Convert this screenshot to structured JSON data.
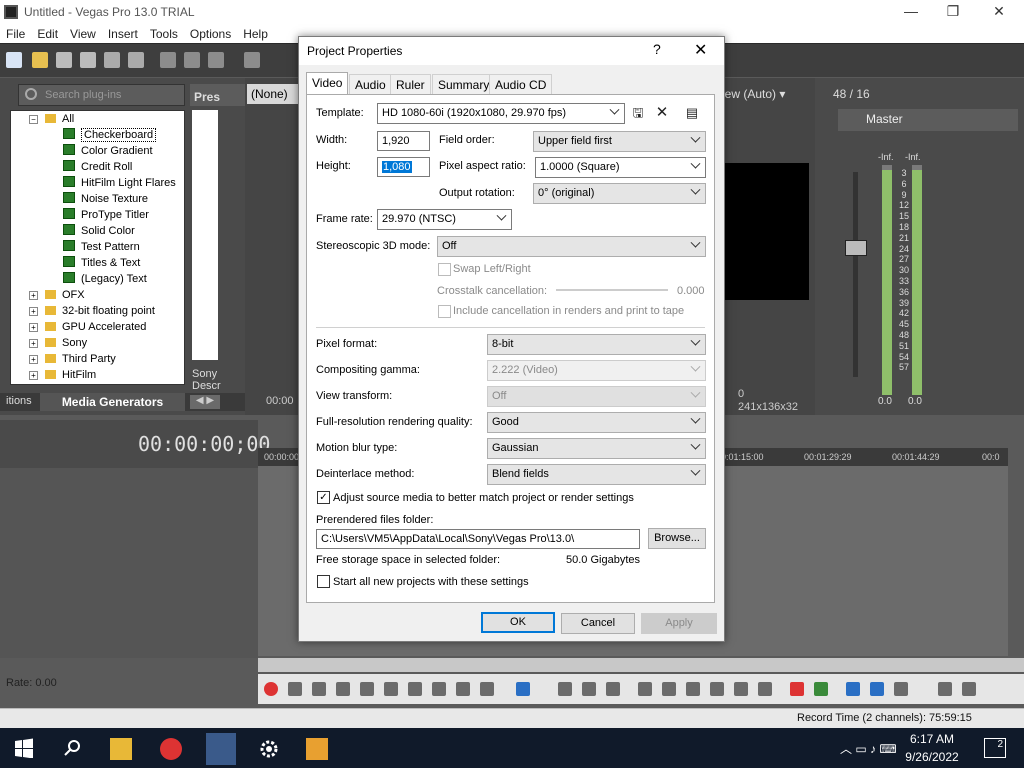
{
  "window": {
    "title": "Untitled - Vegas Pro 13.0 TRIAL",
    "min": "—",
    "max": "❐",
    "close": "✕"
  },
  "menu": [
    "File",
    "Edit",
    "View",
    "Insert",
    "Tools",
    "Options",
    "Help"
  ],
  "left_panel": {
    "search_placeholder": "Search plug-ins",
    "presets_tab": "Pres",
    "tree": {
      "root": "All",
      "generators": [
        "Checkerboard",
        "Color Gradient",
        "Credit Roll",
        "HitFilm Light Flares",
        "Noise Texture",
        "ProType Titler",
        "Solid Color",
        "Test Pattern",
        "Titles & Text",
        "(Legacy) Text"
      ],
      "folders": [
        "OFX",
        "32-bit floating point",
        "GPU Accelerated",
        "Sony",
        "Third Party",
        "HitFilm"
      ]
    },
    "preset_desc": [
      "Sony",
      "Descr"
    ],
    "tab_partial": "itions",
    "tab_active": "Media Generators"
  },
  "preview": {
    "none_dropdown": "(None)",
    "view_mode": "iew (Auto)",
    "frame": "0",
    "resolution": "241x136x32",
    "small_timecode": "00:00"
  },
  "mixer": {
    "header": "48 / 16",
    "master": "Master",
    "inf_left": "-Inf.",
    "inf_right": "-Inf.",
    "scale": [
      "3",
      "6",
      "9",
      "12",
      "15",
      "18",
      "21",
      "24",
      "27",
      "30",
      "33",
      "36",
      "39",
      "42",
      "45",
      "48",
      "51",
      "54",
      "57"
    ],
    "level_left": "0.0",
    "level_right": "0.0"
  },
  "timeline": {
    "timecode": "00:00:00;00",
    "ruler": [
      "00:00:00",
      "00:01:15:00",
      "00:01:29:29",
      "00:01:44:29",
      "00:0"
    ],
    "rate": "Rate: 0.00",
    "record_time": "Record Time (2 channels): 75:59:15"
  },
  "taskbar": {
    "time": "6:17 AM",
    "date": "9/26/2022",
    "notifications": "2"
  },
  "dialog": {
    "title": "Project Properties",
    "help": "?",
    "close": "✕",
    "tabs": [
      "Video",
      "Audio",
      "Ruler",
      "Summary",
      "Audio CD"
    ],
    "active_tab": "Video",
    "template_label": "Template:",
    "template_value": "HD 1080-60i (1920x1080, 29.970 fps)",
    "width_label": "Width:",
    "width_value": "1,920",
    "height_label": "Height:",
    "height_value": "1,080",
    "field_order_label": "Field order:",
    "field_order_value": "Upper field first",
    "par_label": "Pixel aspect ratio:",
    "par_value": "1.0000 (Square)",
    "output_rotation_label": "Output rotation:",
    "output_rotation_value": "0° (original)",
    "frame_rate_label": "Frame rate:",
    "frame_rate_value": "29.970 (NTSC)",
    "stereo_label": "Stereoscopic 3D mode:",
    "stereo_value": "Off",
    "swap_label": "Swap Left/Right",
    "crosstalk_label": "Crosstalk cancellation:",
    "crosstalk_value": "0.000",
    "include_cancel_label": "Include cancellation in renders and print to tape",
    "pixel_format_label": "Pixel format:",
    "pixel_format_value": "8-bit",
    "gamma_label": "Compositing gamma:",
    "gamma_value": "2.222 (Video)",
    "view_transform_label": "View transform:",
    "view_transform_value": "Off",
    "quality_label": "Full-resolution rendering quality:",
    "quality_value": "Good",
    "motion_blur_label": "Motion blur type:",
    "motion_blur_value": "Gaussian",
    "deinterlace_label": "Deinterlace method:",
    "deinterlace_value": "Blend fields",
    "adjust_label": "Adjust source media to better match project or render settings",
    "adjust_checked": true,
    "prerender_label": "Prerendered files folder:",
    "prerender_value": "C:\\Users\\VM5\\AppData\\Local\\Sony\\Vegas Pro\\13.0\\",
    "browse": "Browse...",
    "free_label": "Free storage space in selected folder:",
    "free_value": "50.0 Gigabytes",
    "start_all_label": "Start all new projects with these settings",
    "ok": "OK",
    "cancel": "Cancel",
    "apply": "Apply"
  }
}
